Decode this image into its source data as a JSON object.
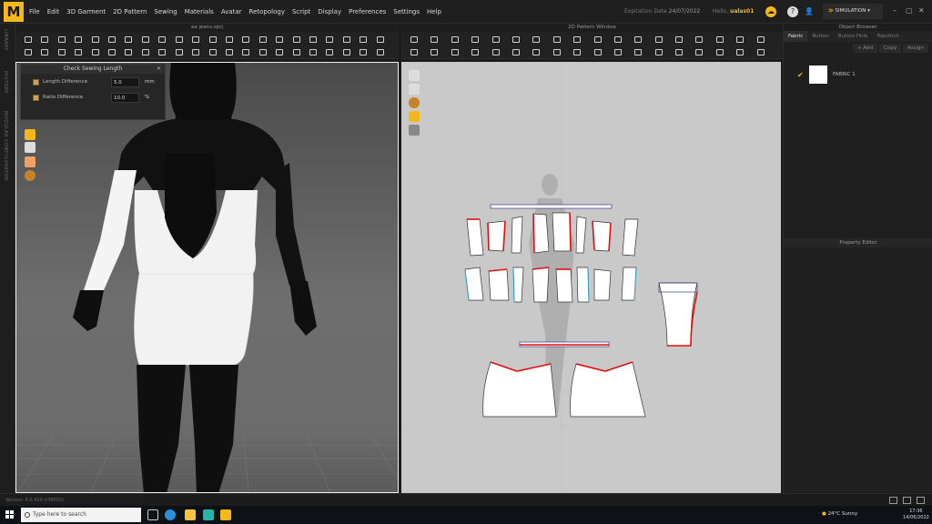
{
  "app": {
    "logo": "M",
    "expiration_label": "Expiration Date",
    "expiration_value": "24/07/2022",
    "hello_label": "Hello,",
    "user": "ualas01",
    "mode": "SIMULATION"
  },
  "menu": [
    "File",
    "Edit",
    "3D Garment",
    "2D Pattern",
    "Sewing",
    "Materials",
    "Avatar",
    "Retopology",
    "Script",
    "Display",
    "Preferences",
    "Settings",
    "Help"
  ],
  "side_tabs": [
    "LIBRARY",
    "HISTORY",
    "MODULAR CONFIGURATOR"
  ],
  "viewport3d": {
    "title": "aa jeans.zprj"
  },
  "viewport2d": {
    "title": "2D Pattern Window"
  },
  "dialog": {
    "title": "Check Sewing Length",
    "length_label": "Length Difference",
    "length_value": "5.0",
    "length_unit": "mm",
    "ratio_label": "Ratio Difference",
    "ratio_value": "10.0",
    "ratio_unit": "%"
  },
  "object_browser": {
    "title": "Object Browser",
    "tabs": [
      "Fabric",
      "Button",
      "Button Hole",
      "Topstitch"
    ],
    "actions": [
      "+ Add",
      "Copy",
      "Assign"
    ],
    "fabric": "FABRIC 1"
  },
  "property_editor": {
    "title": "Property Editor"
  },
  "status": {
    "version": "Version: 6.0.420 (r38650)"
  },
  "taskbar": {
    "search_placeholder": "Type here to search",
    "weather": "24°C  Sunny",
    "time": "17:36",
    "date": "14/06/2022"
  },
  "colors": {
    "accent": "#f5b81a",
    "seam": "#e01010"
  }
}
